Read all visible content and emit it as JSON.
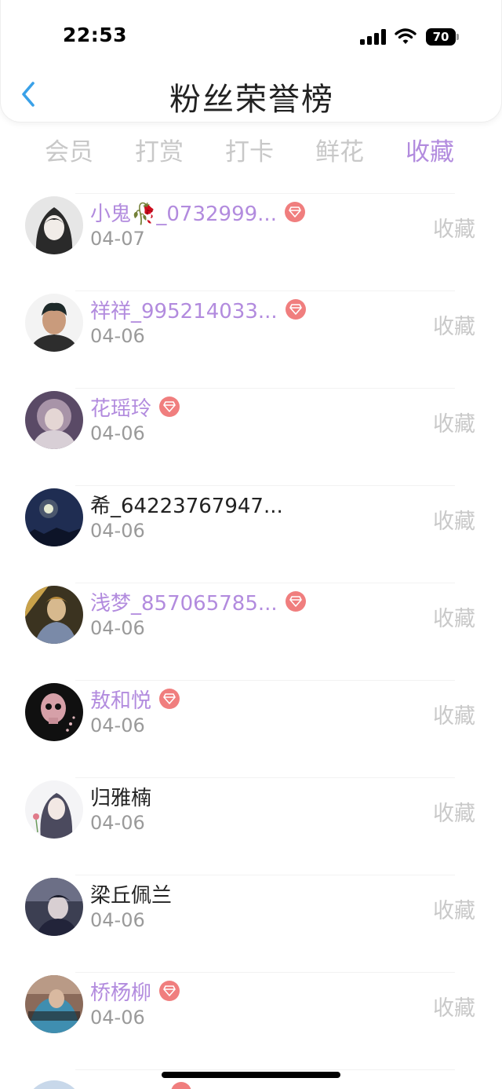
{
  "status_bar": {
    "time": "22:53",
    "battery_level": "70"
  },
  "nav": {
    "title": "粉丝荣誉榜",
    "back_icon": "chevron-left-icon"
  },
  "tabs": [
    {
      "label": "会员",
      "active": false
    },
    {
      "label": "打赏",
      "active": false
    },
    {
      "label": "打卡",
      "active": false
    },
    {
      "label": "鲜花",
      "active": false
    },
    {
      "label": "收藏",
      "active": true
    }
  ],
  "colors": {
    "accent": "#b28bde",
    "vip_badge": "#f07e7e",
    "muted": "#9a9a9a",
    "action": "#c9c9c9"
  },
  "fans": [
    {
      "name": "小鬼🥀_0732999...",
      "date": "04-07",
      "vip": true,
      "action": "收藏"
    },
    {
      "name": "祥祥_995214033...",
      "date": "04-06",
      "vip": true,
      "action": "收藏"
    },
    {
      "name": "花瑶玲",
      "date": "04-06",
      "vip": true,
      "action": "收藏"
    },
    {
      "name": "希_64223767947...",
      "date": "04-06",
      "vip": false,
      "action": "收藏"
    },
    {
      "name": "浅梦_857065785...",
      "date": "04-06",
      "vip": true,
      "action": "收藏"
    },
    {
      "name": "敖和悦",
      "date": "04-06",
      "vip": true,
      "action": "收藏"
    },
    {
      "name": "归雅楠",
      "date": "04-06",
      "vip": false,
      "action": "收藏"
    },
    {
      "name": "梁丘佩兰",
      "date": "04-06",
      "vip": false,
      "action": "收藏"
    },
    {
      "name": "桥杨柳",
      "date": "04-06",
      "vip": true,
      "action": "收藏"
    }
  ]
}
